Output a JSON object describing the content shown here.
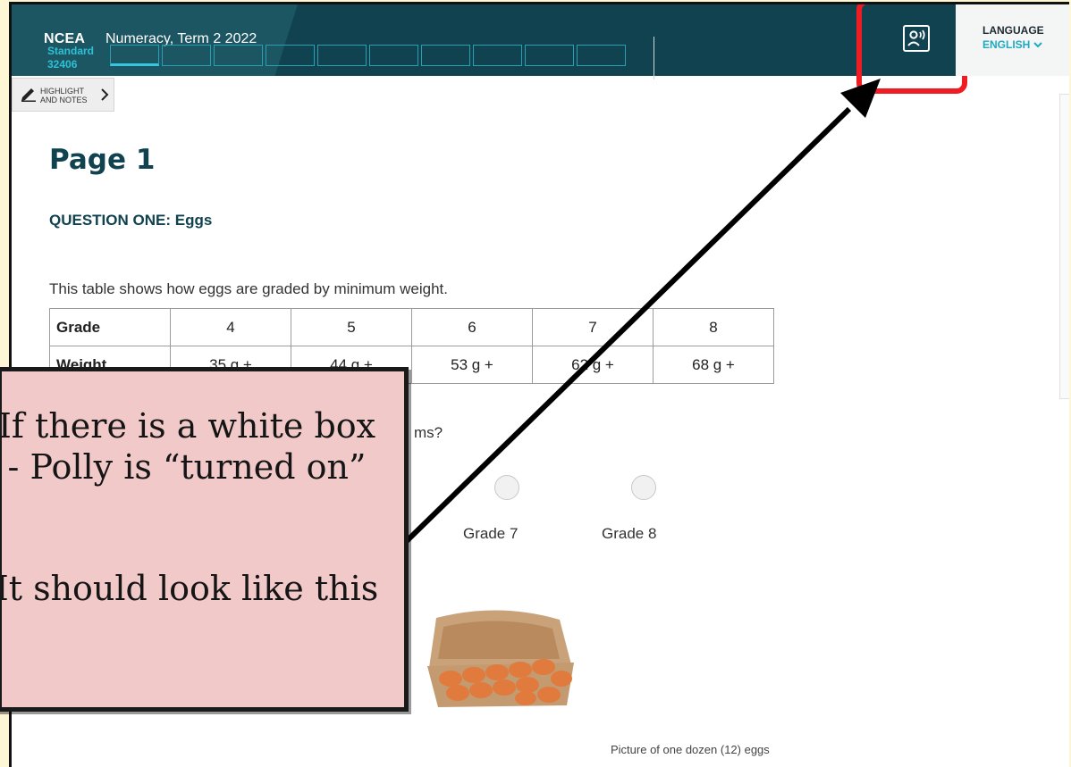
{
  "header": {
    "brand": "NCEA",
    "assessment_title": "Numeracy, Term 2 2022",
    "standard_label": "Standard",
    "standard_number": "32406",
    "progress_segments": 10,
    "active_segment": 1,
    "text_to_speech_icon": "speaker-person-icon"
  },
  "language": {
    "label": "LANGUAGE",
    "value": "ENGLISH"
  },
  "highlight_tab": {
    "line1": "HIGHLIGHT",
    "line2": "AND NOTES",
    "icon": "pencil-icon"
  },
  "page": {
    "heading": "Page 1",
    "question_title": "QUESTION ONE: Eggs",
    "intro": "This table shows how eggs are graded by minimum weight.",
    "table": {
      "rows": [
        [
          "Grade",
          "4",
          "5",
          "6",
          "7",
          "8"
        ],
        [
          "Weight",
          "35 g +",
          "44 g +",
          "53 g +",
          "62 g +",
          "68 g +"
        ]
      ]
    },
    "question_fragment": "ms?",
    "options": [
      "Grade 7",
      "Grade 8"
    ],
    "image_caption": "Picture of one dozen (12) eggs"
  },
  "annotation": {
    "callout_line1": "If there is a white box - Polly is “turned on”",
    "callout_line2": "It should look like this",
    "highlight_color": "#ef1c23",
    "callout_bg": "#f2c9c9"
  },
  "colors": {
    "header_bg": "#10434f",
    "accent": "#1fa9c3"
  }
}
